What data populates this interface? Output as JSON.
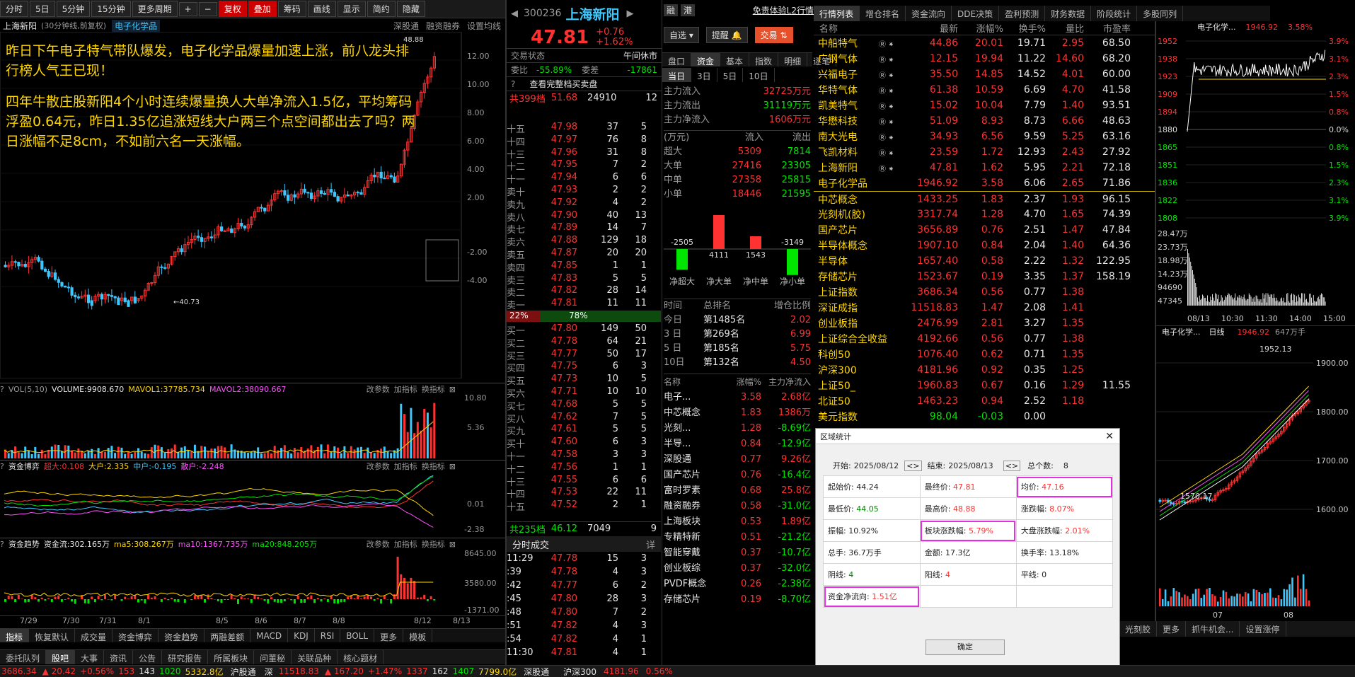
{
  "toolbar": {
    "items": [
      "分时",
      "5日",
      "5分钟",
      "15分钟",
      "更多周期",
      "+",
      "−",
      "复权",
      "叠加",
      "筹码",
      "画线",
      "显示",
      "简约",
      "隐藏"
    ]
  },
  "chart_header": {
    "stock": "上海新阳",
    "mode": "(30分钟线,前复权)",
    "sector": "电子化学品",
    "links": [
      "深股通",
      "融资融券",
      "设置均线"
    ]
  },
  "news": {
    "p1": "昨日下午电子特气带队爆发，电子化学品爆量加速上涨，前八龙头排行榜人气王已现！",
    "p2": "四年牛散庄股新阳4个小时连续爆量换人大单净流入1.5亿，平均筹码浮盈0.64元，昨日1.35亿追涨短线大户两三个点空间都出去了吗？两日涨幅不足8cm，不如前六名一天涨幅。"
  },
  "axis_main": [
    "12.00",
    "10.00",
    "8.00",
    "6.00",
    "4.00",
    "2.00",
    "-2.00",
    "-4.00"
  ],
  "annot": {
    "hi": "48.88",
    "lo": "40.73"
  },
  "vol": {
    "label": "VOL(5,10)",
    "v": "VOLUME:9908.670",
    "m1": "MAVOL1:37785.734",
    "m2": "MAVOL2:38090.667",
    "axis": [
      "10.80",
      "5.36"
    ]
  },
  "fund": {
    "label": "资金博弈",
    "a": "超大:0.108",
    "b": "大户:2.335",
    "c": "中户:-0.195",
    "d": "散户:-2.248",
    "axis": [
      "0.01",
      "-2.38"
    ]
  },
  "trend": {
    "label": "资金趋势",
    "a": "资金流:302.165万",
    "b": "ma5:308.267万",
    "c": "ma10:1367.735万",
    "d": "ma20:848.205万",
    "axis": [
      "8645.00",
      "3580.00",
      "-1371.00"
    ]
  },
  "panel_tools": [
    "改参数",
    "加指标",
    "换指标"
  ],
  "dates": [
    "7/29",
    "7/30",
    "7/31",
    "8/1",
    "8/5",
    "8/6",
    "8/7",
    "8/8",
    "8/12",
    "8/13"
  ],
  "bottom_tabs": [
    "指标",
    "恢复默认",
    "成交量",
    "资金博弈",
    "资金趋势",
    "两融差额",
    "MACD",
    "KDJ",
    "RSI",
    "BOLL",
    "更多",
    "模板"
  ],
  "lower_tabs": [
    "委托队列",
    "股吧",
    "大事",
    "资讯",
    "公告",
    "研究报告",
    "所属板块",
    "问董秘",
    "关联品种",
    "核心题材"
  ],
  "quote": {
    "code": "300236",
    "name": "上海新阳",
    "price": "47.81",
    "chg": "+0.76",
    "pct": "+1.62%",
    "rz": "融",
    "gang": "港",
    "l2": "免责体验L2行情",
    "zixuan": "自选",
    "tixing": "提醒",
    "jiaoyi": "交易",
    "state_l": "交易状态",
    "state_r": "午间休市",
    "wb": "委比",
    "wb_v": "-55.89%",
    "wc": "委差",
    "wc_v": "-17861",
    "full": "查看完整档买卖盘",
    "sell_tot": "共399档",
    "sell_avg": "51.68",
    "sell_vol": "24910",
    "sell_n": "12",
    "buy_tot": "共235档",
    "buy_avg": "46.12",
    "buy_vol": "7049",
    "buy_n": "9",
    "pct_l": "22%",
    "pct_r": "78%"
  },
  "asks": [
    [
      "十五",
      "47.98",
      "37",
      "5"
    ],
    [
      "十四",
      "47.97",
      "76",
      "8"
    ],
    [
      "十三",
      "47.96",
      "31",
      "8"
    ],
    [
      "十二",
      "47.95",
      "7",
      "2"
    ],
    [
      "十一",
      "47.94",
      "6",
      "6"
    ],
    [
      "卖十",
      "47.93",
      "2",
      "2"
    ],
    [
      "卖九",
      "47.92",
      "4",
      "2"
    ],
    [
      "卖八",
      "47.90",
      "40",
      "13"
    ],
    [
      "卖七",
      "47.89",
      "14",
      "7"
    ],
    [
      "卖六",
      "47.88",
      "129",
      "18"
    ],
    [
      "卖五",
      "47.87",
      "20",
      "20"
    ],
    [
      "卖四",
      "47.85",
      "1",
      "1"
    ],
    [
      "卖三",
      "47.83",
      "5",
      "5"
    ],
    [
      "卖二",
      "47.82",
      "28",
      "14"
    ],
    [
      "卖一",
      "47.81",
      "11",
      "11"
    ]
  ],
  "bids": [
    [
      "买一",
      "47.80",
      "149",
      "50"
    ],
    [
      "买二",
      "47.78",
      "64",
      "21"
    ],
    [
      "买三",
      "47.77",
      "50",
      "17"
    ],
    [
      "买四",
      "47.75",
      "6",
      "3"
    ],
    [
      "买五",
      "47.73",
      "10",
      "5"
    ],
    [
      "买六",
      "47.71",
      "10",
      "10"
    ],
    [
      "买七",
      "47.68",
      "5",
      "5"
    ],
    [
      "买八",
      "47.62",
      "7",
      "5"
    ],
    [
      "买九",
      "47.61",
      "5",
      "5"
    ],
    [
      "买十",
      "47.60",
      "6",
      "3"
    ],
    [
      "十一",
      "47.58",
      "3",
      "3"
    ],
    [
      "十二",
      "47.56",
      "1",
      "1"
    ],
    [
      "十三",
      "47.55",
      "6",
      "6"
    ],
    [
      "十四",
      "47.53",
      "22",
      "11"
    ],
    [
      "十五",
      "47.52",
      "2",
      "1"
    ]
  ],
  "trades_title": "分时成交",
  "trades_more": "详",
  "trades": [
    [
      "11:29",
      "47.78",
      "15",
      "3"
    ],
    [
      ":39",
      "47.78",
      "4",
      "3"
    ],
    [
      ":42",
      "47.77",
      "6",
      "2"
    ],
    [
      ":45",
      "47.80",
      "28",
      "3"
    ],
    [
      ":48",
      "47.80",
      "7",
      "2"
    ],
    [
      ":51",
      "47.82",
      "4",
      "3"
    ],
    [
      ":54",
      "47.82",
      "4",
      "1"
    ],
    [
      "11:30",
      "47.81",
      "4",
      "1"
    ]
  ],
  "flow_tabs": [
    "盘口",
    "资金",
    "基本",
    "指数",
    "明细",
    "逐笔"
  ],
  "flow_days": [
    "当日",
    "3日",
    "5日",
    "10日"
  ],
  "flow": {
    "in_l": "主力流入",
    "in_v": "32725万元",
    "out_l": "主力流出",
    "out_v": "31119万元",
    "net_l": "主力净流入",
    "net_v": "1606万元",
    "unit": "(万元)",
    "h1": "流入",
    "h2": "流出",
    "rows": [
      [
        "超大",
        "5309",
        "7814"
      ],
      [
        "大单",
        "27416",
        "23305"
      ],
      [
        "中单",
        "27358",
        "25815"
      ],
      [
        "小单",
        "18446",
        "21595"
      ]
    ],
    "bars": [
      "-2505",
      "4111",
      "1543",
      "-3149"
    ],
    "bar_labels": [
      "净超大",
      "净大单",
      "净中单",
      "净小单"
    ]
  },
  "rank": {
    "h": [
      "时间",
      "总排名",
      "增仓比例"
    ],
    "rows": [
      [
        "今日",
        "第1485名",
        "2.02"
      ],
      [
        "3 日",
        "第269名",
        "6.99"
      ],
      [
        "5 日",
        "第185名",
        "5.75"
      ],
      [
        "10日",
        "第132名",
        "4.50"
      ]
    ]
  },
  "sector": {
    "h": [
      "名称",
      "涨幅%",
      "主力净流入"
    ],
    "rows": [
      [
        "电子...",
        "3.58",
        "2.68亿"
      ],
      [
        "中芯概念",
        "1.83",
        "1386万"
      ],
      [
        "光刻...",
        "1.28",
        "-8.69亿"
      ],
      [
        "半导...",
        "0.84",
        "-12.9亿"
      ],
      [
        "深股通",
        "0.77",
        "9.26亿"
      ],
      [
        "国产芯片",
        "0.76",
        "-16.4亿"
      ],
      [
        "富时罗素",
        "0.68",
        "25.8亿"
      ],
      [
        "融资融券",
        "0.58",
        "-31.0亿"
      ],
      [
        "上海板块",
        "0.53",
        "1.89亿"
      ],
      [
        "专精特新",
        "0.51",
        "-21.2亿"
      ],
      [
        "智能穿戴",
        "0.37",
        "-10.7亿"
      ],
      [
        "创业板综",
        "0.37",
        "-32.0亿"
      ],
      [
        "PVDF概念",
        "0.26",
        "-2.38亿"
      ],
      [
        "存储芯片",
        "0.19",
        "-8.70亿"
      ]
    ]
  },
  "list_tabs": [
    "行情列表",
    "增仓排名",
    "资金流向",
    "DDE决策",
    "盈利预测",
    "财务数据",
    "阶段统计",
    "多股同列"
  ],
  "list_head": [
    "名称",
    "",
    "",
    "最新",
    "涨幅%",
    "换手%",
    "量比",
    "市盈率"
  ],
  "list": [
    [
      "中船特气",
      "44.86",
      "20.01",
      "19.71",
      "2.95",
      "68.50"
    ],
    [
      "广钢气体",
      "12.15",
      "19.94",
      "11.22",
      "14.60",
      "68.20"
    ],
    [
      "兴福电子",
      "35.50",
      "14.85",
      "14.52",
      "4.01",
      "60.00"
    ],
    [
      "华特气体",
      "61.38",
      "10.59",
      "6.69",
      "4.70",
      "41.58"
    ],
    [
      "凯美特气",
      "15.02",
      "10.04",
      "7.79",
      "1.40",
      "93.51"
    ],
    [
      "华懋科技",
      "51.09",
      "8.93",
      "8.73",
      "6.66",
      "48.63"
    ],
    [
      "南大光电",
      "34.93",
      "6.56",
      "9.59",
      "5.25",
      "63.16"
    ],
    [
      "飞凯材料",
      "23.59",
      "1.72",
      "12.93",
      "2.43",
      "27.92"
    ],
    [
      "上海新阳",
      "47.81",
      "1.62",
      "5.95",
      "2.21",
      "72.18"
    ],
    [
      "电子化学品",
      "1946.92",
      "3.58",
      "6.06",
      "2.65",
      "71.86"
    ],
    [
      "中芯概念",
      "1433.25",
      "1.83",
      "2.37",
      "1.93",
      "96.15"
    ],
    [
      "光刻机(胶)",
      "3317.74",
      "1.28",
      "4.70",
      "1.65",
      "74.39"
    ],
    [
      "国产芯片",
      "3656.89",
      "0.76",
      "2.51",
      "1.47",
      "47.84"
    ],
    [
      "半导体概念",
      "1907.10",
      "0.84",
      "2.04",
      "1.40",
      "64.36"
    ],
    [
      "半导体",
      "1657.40",
      "0.58",
      "2.22",
      "1.32",
      "122.95"
    ],
    [
      "存储芯片",
      "1523.67",
      "0.19",
      "3.35",
      "1.37",
      "158.19"
    ],
    [
      "上证指数",
      "3686.34",
      "0.56",
      "0.77",
      "1.38",
      ""
    ],
    [
      "深证成指",
      "11518.83",
      "1.47",
      "2.08",
      "1.41",
      ""
    ],
    [
      "创业板指",
      "2476.99",
      "2.81",
      "3.27",
      "1.35",
      ""
    ],
    [
      "上证综合全收益",
      "4192.66",
      "0.56",
      "0.77",
      "1.38",
      ""
    ],
    [
      "科创50",
      "1076.40",
      "0.62",
      "0.71",
      "1.35",
      ""
    ],
    [
      "沪深300",
      "4181.96",
      "0.92",
      "0.35",
      "1.25",
      ""
    ],
    [
      "上证50_",
      "1960.83",
      "0.67",
      "0.16",
      "1.29",
      "11.55"
    ],
    [
      "北证50",
      "1463.23",
      "0.94",
      "2.52",
      "1.18",
      ""
    ],
    [
      "美元指数",
      "98.04",
      "-0.03",
      "0.00",
      "",
      ""
    ]
  ],
  "mini1": {
    "title": "电子化学...",
    "price": "1946.92",
    "pct": "3.58%",
    "ylabels": [
      "1952",
      "1938",
      "1923",
      "1909",
      "1894",
      "1880",
      "1865",
      "1851",
      "1836",
      "1822",
      "1808"
    ],
    "pcts": [
      "3.9%",
      "3.1%",
      "2.3%",
      "1.5%",
      "0.8%",
      "0.0%",
      "0.8%",
      "1.5%",
      "2.3%",
      "3.1%",
      "3.9%"
    ],
    "vlabels": [
      "28.47万",
      "23.73万",
      "18.98万",
      "14.23万",
      "94690",
      "47345"
    ],
    "times": [
      "08/13",
      "10:30",
      "11:30",
      "14:00",
      "15:00"
    ]
  },
  "mini2": {
    "title": "电子化学...",
    "period": "日线",
    "price": "1946.92",
    "vol": "647万手",
    "hi": "1952.13",
    "lo": "1570.17",
    "axis": [
      "1900.00",
      "1800.00",
      "1700.00",
      "1600.00"
    ],
    "dates": [
      "07",
      "08"
    ]
  },
  "mini_tabs": [
    "光刻胶",
    "更多",
    "抓牛机会...",
    "设置涨停"
  ],
  "modal": {
    "title": "区域统计",
    "start_l": "开始:",
    "start": "2025/08/12",
    "end_l": "结束:",
    "end": "2025/08/13",
    "total_l": "总个数:",
    "total": "8",
    "open_l": "起始价:",
    "open": "44.24",
    "close_l": "最终价:",
    "close": "47.81",
    "avg_l": "均价:",
    "avg": "47.16",
    "low_l": "最低价:",
    "low": "44.05",
    "high_l": "最高价:",
    "high": "48.88",
    "chg_l": "涨跌幅:",
    "chg": "8.07%",
    "amp_l": "振幅:",
    "amp": "10.92%",
    "sec_l": "板块涨跌幅:",
    "sec": "5.79%",
    "mkt_l": "大盘涨跌幅:",
    "mkt": "2.01%",
    "hand_l": "总手:",
    "hand": "36.7万手",
    "amt_l": "金额:",
    "amt": "17.3亿",
    "turn_l": "换手率:",
    "turn": "13.18%",
    "yin_l": "阴线:",
    "yin": "4",
    "yang_l": "阳线:",
    "yang": "4",
    "flat_l": "平线:",
    "flat": "0",
    "net_l": "资金净流向:",
    "net": "1.51亿",
    "ok": "确定"
  },
  "status": {
    "a": "3686.34",
    "b": "20.42",
    "c": "+0.56%",
    "d": "153",
    "e": "143",
    "f": "1020",
    "g": "5332.8亿",
    "h": "沪股通",
    "i": "深",
    "j": "11518.83",
    "k": "167.20",
    "l": "+1.47%",
    "m": "1337",
    "n": "162",
    "o": "1407",
    "p": "7799.0亿",
    "q": "深股通",
    "s": "沪深300",
    "t": "4181.96",
    "u": "0.56%"
  }
}
